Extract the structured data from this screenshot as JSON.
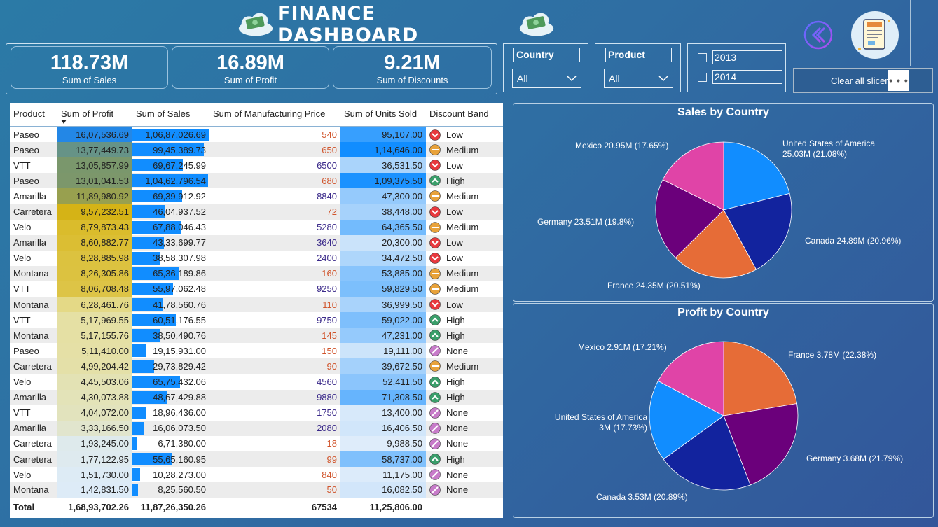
{
  "header": {
    "title": "FINANCE DASHBOARD"
  },
  "kpis": [
    {
      "value": "118.73M",
      "label": "Sum of Sales"
    },
    {
      "value": "16.89M",
      "label": "Sum of Profit"
    },
    {
      "value": "9.21M",
      "label": "Sum of Discounts"
    }
  ],
  "slicers": {
    "country": {
      "title": "Country",
      "value": "All"
    },
    "product": {
      "title": "Product",
      "value": "All"
    },
    "years": [
      "2013",
      "2014"
    ],
    "clear_label": "Clear all slicer",
    "more_label": "• • •"
  },
  "table": {
    "columns": [
      "Product",
      "Sum of Profit",
      "Sum of Sales",
      "Sum of Manufacturing Price",
      "Sum of Units Sold",
      "Discount Band"
    ],
    "rows": [
      {
        "product": "Paseo",
        "profit": "16,07,536.69",
        "profit_v": 16.08,
        "sales": "1,06,87,026.69",
        "sales_v": 106.87,
        "mfg": "540",
        "units": "95,107.00",
        "units_v": 95107,
        "band": "Low"
      },
      {
        "product": "Paseo",
        "profit": "13,77,449.73",
        "profit_v": 13.77,
        "sales": "99,45,389.73",
        "sales_v": 99.45,
        "mfg": "650",
        "units": "1,14,646.00",
        "units_v": 114646,
        "band": "Medium"
      },
      {
        "product": "VTT",
        "profit": "13,05,857.99",
        "profit_v": 13.06,
        "sales": "69,67,245.99",
        "sales_v": 69.67,
        "mfg": "6500",
        "units": "36,531.50",
        "units_v": 36531,
        "band": "Low"
      },
      {
        "product": "Paseo",
        "profit": "13,01,041.53",
        "profit_v": 13.01,
        "sales": "1,04,62,796.54",
        "sales_v": 104.63,
        "mfg": "680",
        "units": "1,09,375.50",
        "units_v": 109375,
        "band": "High"
      },
      {
        "product": "Amarilla",
        "profit": "11,89,980.92",
        "profit_v": 11.9,
        "sales": "69,39,912.92",
        "sales_v": 69.4,
        "mfg": "8840",
        "units": "47,300.00",
        "units_v": 47300,
        "band": "Medium"
      },
      {
        "product": "Carretera",
        "profit": "9,57,232.51",
        "profit_v": 9.57,
        "sales": "46,04,937.52",
        "sales_v": 46.05,
        "mfg": "72",
        "units": "38,448.00",
        "units_v": 38448,
        "band": "Low"
      },
      {
        "product": "Velo",
        "profit": "8,79,873.43",
        "profit_v": 8.8,
        "sales": "67,88,046.43",
        "sales_v": 67.88,
        "mfg": "5280",
        "units": "64,365.50",
        "units_v": 64365,
        "band": "Medium"
      },
      {
        "product": "Amarilla",
        "profit": "8,60,882.77",
        "profit_v": 8.61,
        "sales": "43,33,699.77",
        "sales_v": 43.34,
        "mfg": "3640",
        "units": "20,300.00",
        "units_v": 20300,
        "band": "Low"
      },
      {
        "product": "Velo",
        "profit": "8,28,885.98",
        "profit_v": 8.29,
        "sales": "38,58,307.98",
        "sales_v": 38.58,
        "mfg": "2400",
        "units": "34,472.50",
        "units_v": 34472,
        "band": "Low"
      },
      {
        "product": "Montana",
        "profit": "8,26,305.86",
        "profit_v": 8.26,
        "sales": "65,36,189.86",
        "sales_v": 65.36,
        "mfg": "160",
        "units": "53,885.00",
        "units_v": 53885,
        "band": "Medium"
      },
      {
        "product": "VTT",
        "profit": "8,06,708.48",
        "profit_v": 8.07,
        "sales": "55,97,062.48",
        "sales_v": 55.97,
        "mfg": "9250",
        "units": "59,829.50",
        "units_v": 59829,
        "band": "Medium"
      },
      {
        "product": "Montana",
        "profit": "6,28,461.76",
        "profit_v": 6.28,
        "sales": "41,78,560.76",
        "sales_v": 41.79,
        "mfg": "110",
        "units": "36,999.50",
        "units_v": 36999,
        "band": "Low"
      },
      {
        "product": "VTT",
        "profit": "5,17,969.55",
        "profit_v": 5.18,
        "sales": "60,51,176.55",
        "sales_v": 60.51,
        "mfg": "9750",
        "units": "59,022.00",
        "units_v": 59022,
        "band": "High"
      },
      {
        "product": "Montana",
        "profit": "5,17,155.76",
        "profit_v": 5.17,
        "sales": "38,50,490.76",
        "sales_v": 38.5,
        "mfg": "145",
        "units": "47,231.00",
        "units_v": 47231,
        "band": "High"
      },
      {
        "product": "Paseo",
        "profit": "5,11,410.00",
        "profit_v": 5.11,
        "sales": "19,15,931.00",
        "sales_v": 19.16,
        "mfg": "150",
        "units": "19,111.00",
        "units_v": 19111,
        "band": "None"
      },
      {
        "product": "Carretera",
        "profit": "4,99,204.42",
        "profit_v": 4.99,
        "sales": "29,73,829.42",
        "sales_v": 29.74,
        "mfg": "90",
        "units": "39,672.50",
        "units_v": 39672,
        "band": "Medium"
      },
      {
        "product": "Velo",
        "profit": "4,45,503.06",
        "profit_v": 4.46,
        "sales": "65,75,432.06",
        "sales_v": 65.75,
        "mfg": "4560",
        "units": "52,411.50",
        "units_v": 52411,
        "band": "High"
      },
      {
        "product": "Amarilla",
        "profit": "4,30,073.88",
        "profit_v": 4.3,
        "sales": "48,67,429.88",
        "sales_v": 48.67,
        "mfg": "9880",
        "units": "71,308.50",
        "units_v": 71308,
        "band": "High"
      },
      {
        "product": "VTT",
        "profit": "4,04,072.00",
        "profit_v": 4.04,
        "sales": "18,96,436.00",
        "sales_v": 18.96,
        "mfg": "1750",
        "units": "13,400.00",
        "units_v": 13400,
        "band": "None"
      },
      {
        "product": "Amarilla",
        "profit": "3,33,166.50",
        "profit_v": 3.33,
        "sales": "16,06,073.50",
        "sales_v": 16.06,
        "mfg": "2080",
        "units": "16,406.50",
        "units_v": 16406,
        "band": "None"
      },
      {
        "product": "Carretera",
        "profit": "1,93,245.00",
        "profit_v": 1.93,
        "sales": "6,71,380.00",
        "sales_v": 6.71,
        "mfg": "18",
        "units": "9,988.50",
        "units_v": 9988,
        "band": "None"
      },
      {
        "product": "Carretera",
        "profit": "1,77,122.95",
        "profit_v": 1.77,
        "sales": "55,65,160.95",
        "sales_v": 55.65,
        "mfg": "99",
        "units": "58,737.00",
        "units_v": 58737,
        "band": "High"
      },
      {
        "product": "Velo",
        "profit": "1,51,730.00",
        "profit_v": 1.52,
        "sales": "10,28,273.00",
        "sales_v": 10.28,
        "mfg": "840",
        "units": "11,175.00",
        "units_v": 11175,
        "band": "None"
      },
      {
        "product": "Montana",
        "profit": "1,42,831.50",
        "profit_v": 1.43,
        "sales": "8,25,560.50",
        "sales_v": 8.26,
        "mfg": "50",
        "units": "16,082.50",
        "units_v": 16082,
        "band": "None"
      }
    ],
    "total": {
      "label": "Total",
      "profit": "1,68,93,702.26",
      "sales": "11,87,26,350.26",
      "mfg": "67534",
      "units": "11,25,806.00"
    }
  },
  "band_colors": {
    "Low": "#e8383d",
    "Medium": "#e8a23a",
    "High": "#3a9e6a",
    "None": "#c77bc9"
  },
  "chart_data": [
    {
      "type": "pie",
      "title": "Sales by Country",
      "slices": [
        {
          "name": "United States of America",
          "label": "United States of America\n25.03M (21.08%)",
          "value": 25.03,
          "color": "#118dff"
        },
        {
          "name": "Canada",
          "label": "Canada 24.89M (20.96%)",
          "value": 24.89,
          "color": "#12239e"
        },
        {
          "name": "France",
          "label": "France 24.35M (20.51%)",
          "value": 24.35,
          "color": "#e66c37"
        },
        {
          "name": "Germany",
          "label": "Germany 23.51M (19.8%)",
          "value": 23.51,
          "color": "#6b007b"
        },
        {
          "name": "Mexico",
          "label": "Mexico 20.95M (17.65%)",
          "value": 20.95,
          "color": "#e044a7"
        }
      ]
    },
    {
      "type": "pie",
      "title": "Profit by Country",
      "slices": [
        {
          "name": "France",
          "label": "France 3.78M (22.38%)",
          "value": 3.78,
          "color": "#e66c37"
        },
        {
          "name": "Germany",
          "label": "Germany 3.68M (21.79%)",
          "value": 3.68,
          "color": "#6b007b"
        },
        {
          "name": "Canada",
          "label": "Canada 3.53M (20.89%)",
          "value": 3.53,
          "color": "#12239e"
        },
        {
          "name": "United States of America",
          "label": "United States of America\n3M (17.73%)",
          "value": 3.0,
          "color": "#118dff"
        },
        {
          "name": "Mexico",
          "label": "Mexico 2.91M (17.21%)",
          "value": 2.91,
          "color": "#e044a7"
        }
      ]
    }
  ]
}
